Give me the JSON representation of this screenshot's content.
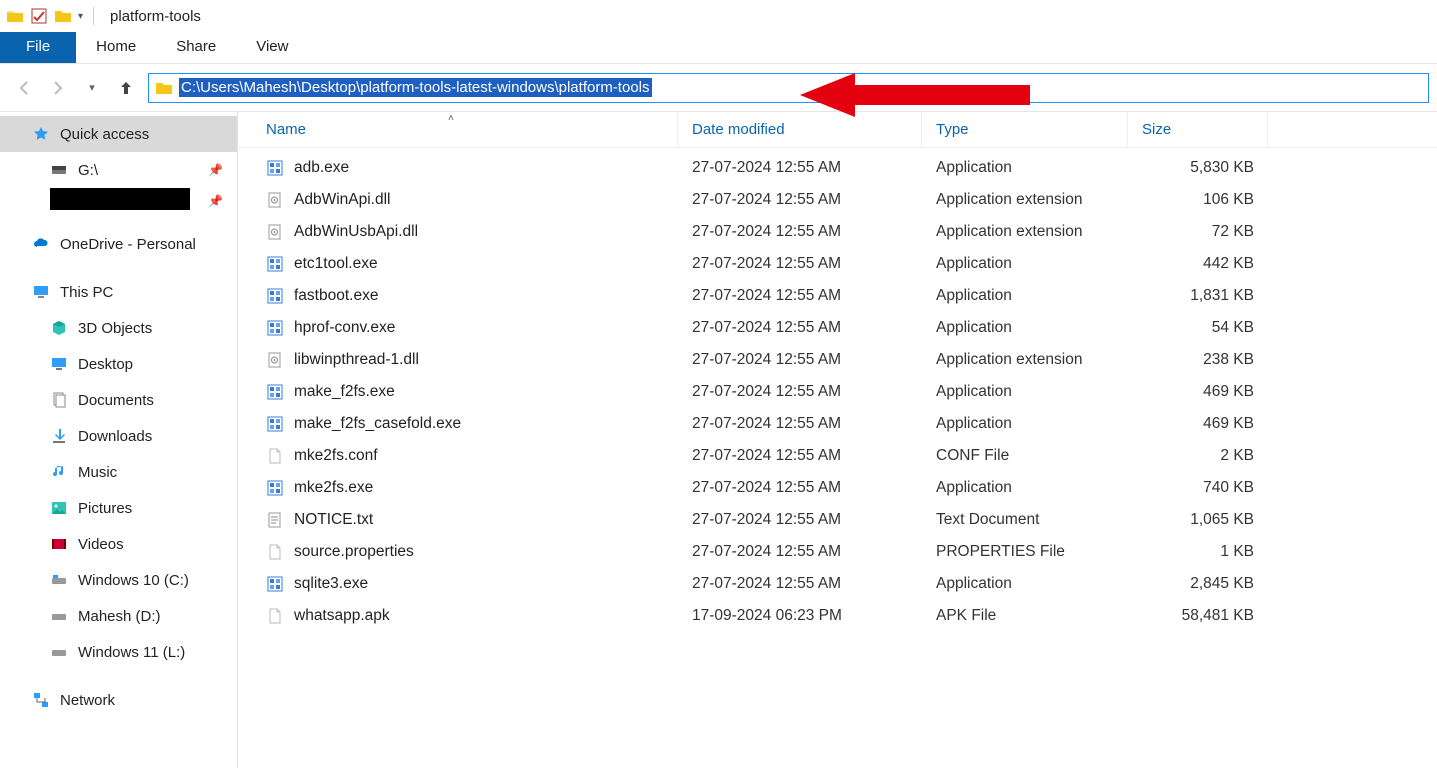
{
  "titlebar": {
    "title": "platform-tools"
  },
  "ribbon": {
    "file": "File",
    "home": "Home",
    "share": "Share",
    "view": "View"
  },
  "address": {
    "path": "C:\\Users\\Mahesh\\Desktop\\platform-tools-latest-windows\\platform-tools"
  },
  "columns": {
    "name": "Name",
    "date": "Date modified",
    "type": "Type",
    "size": "Size"
  },
  "sidebar": {
    "quick_access": "Quick access",
    "g_drive": "G:\\",
    "onedrive": "OneDrive - Personal",
    "this_pc": "This PC",
    "objects3d": "3D Objects",
    "desktop": "Desktop",
    "documents": "Documents",
    "downloads": "Downloads",
    "music": "Music",
    "pictures": "Pictures",
    "videos": "Videos",
    "win10c": "Windows 10 (C:)",
    "maheshd": "Mahesh (D:)",
    "win11l": "Windows 11 (L:)",
    "network": "Network"
  },
  "files": [
    {
      "name": "adb.exe",
      "date": "27-07-2024 12:55 AM",
      "type": "Application",
      "size": "5,830 KB",
      "icon": "exe"
    },
    {
      "name": "AdbWinApi.dll",
      "date": "27-07-2024 12:55 AM",
      "type": "Application extension",
      "size": "106 KB",
      "icon": "dll"
    },
    {
      "name": "AdbWinUsbApi.dll",
      "date": "27-07-2024 12:55 AM",
      "type": "Application extension",
      "size": "72 KB",
      "icon": "dll"
    },
    {
      "name": "etc1tool.exe",
      "date": "27-07-2024 12:55 AM",
      "type": "Application",
      "size": "442 KB",
      "icon": "exe"
    },
    {
      "name": "fastboot.exe",
      "date": "27-07-2024 12:55 AM",
      "type": "Application",
      "size": "1,831 KB",
      "icon": "exe"
    },
    {
      "name": "hprof-conv.exe",
      "date": "27-07-2024 12:55 AM",
      "type": "Application",
      "size": "54 KB",
      "icon": "exe"
    },
    {
      "name": "libwinpthread-1.dll",
      "date": "27-07-2024 12:55 AM",
      "type": "Application extension",
      "size": "238 KB",
      "icon": "dll"
    },
    {
      "name": "make_f2fs.exe",
      "date": "27-07-2024 12:55 AM",
      "type": "Application",
      "size": "469 KB",
      "icon": "exe"
    },
    {
      "name": "make_f2fs_casefold.exe",
      "date": "27-07-2024 12:55 AM",
      "type": "Application",
      "size": "469 KB",
      "icon": "exe"
    },
    {
      "name": "mke2fs.conf",
      "date": "27-07-2024 12:55 AM",
      "type": "CONF File",
      "size": "2 KB",
      "icon": "file"
    },
    {
      "name": "mke2fs.exe",
      "date": "27-07-2024 12:55 AM",
      "type": "Application",
      "size": "740 KB",
      "icon": "exe"
    },
    {
      "name": "NOTICE.txt",
      "date": "27-07-2024 12:55 AM",
      "type": "Text Document",
      "size": "1,065 KB",
      "icon": "txt"
    },
    {
      "name": "source.properties",
      "date": "27-07-2024 12:55 AM",
      "type": "PROPERTIES File",
      "size": "1 KB",
      "icon": "file"
    },
    {
      "name": "sqlite3.exe",
      "date": "27-07-2024 12:55 AM",
      "type": "Application",
      "size": "2,845 KB",
      "icon": "exe"
    },
    {
      "name": "whatsapp.apk",
      "date": "17-09-2024 06:23 PM",
      "type": "APK File",
      "size": "58,481 KB",
      "icon": "file"
    }
  ]
}
